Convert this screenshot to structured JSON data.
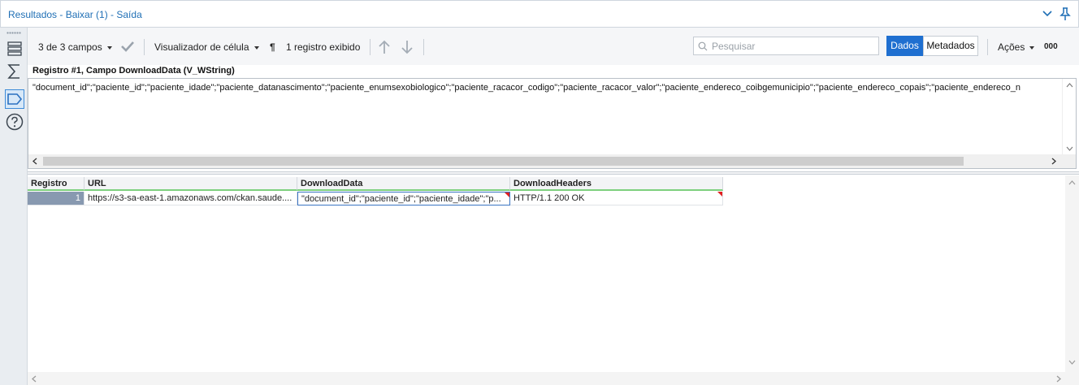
{
  "window": {
    "title": "Resultados - Baixar (1) - Saída"
  },
  "toolbar": {
    "fields_label": "3 de 3 campos",
    "cell_viewer_label": "Visualizador de célula",
    "records_shown": "1 registro exibido",
    "search_placeholder": "Pesquisar",
    "data_tab": "Dados",
    "metadata_tab": "Metadados",
    "actions_label": "Ações",
    "more_label": "000"
  },
  "record": {
    "header": "Registro #1, Campo DownloadData (V_WString)",
    "content": "\"document_id\";\"paciente_id\";\"paciente_idade\";\"paciente_datanascimento\";\"paciente_enumsexobiologico\";\"paciente_racacor_codigo\";\"paciente_racacor_valor\";\"paciente_endereco_coibgemunicipio\";\"paciente_endereco_copais\";\"paciente_endereco_n"
  },
  "grid": {
    "columns": [
      "Registro",
      "URL",
      "DownloadData",
      "DownloadHeaders"
    ],
    "rows": [
      [
        "1",
        "https://s3-sa-east-1.amazonaws.com/ckan.saude....",
        "\"document_id\";\"paciente_id\";\"paciente_idade\";\"p...",
        "HTTP/1.1 200 OK"
      ]
    ]
  },
  "colors": {
    "accent": "#1f6fd0",
    "header_underline": "#7ed07e",
    "row_number_bg": "#8899b0",
    "truncation_marker": "#e02020"
  }
}
